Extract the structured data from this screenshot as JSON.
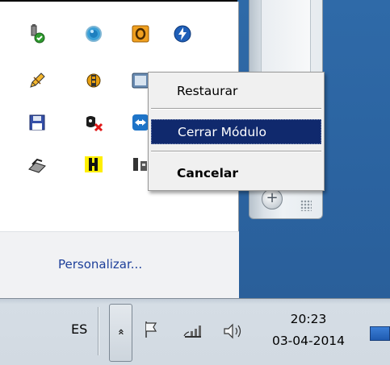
{
  "context_menu": {
    "items": [
      {
        "label": "Restaurar"
      },
      {
        "label": "Cerrar Módulo"
      },
      {
        "label": "Cancelar"
      }
    ]
  },
  "overflow_panel": {
    "customize_label": "Personalizar...",
    "icons": [
      "usb-device-icon",
      "blue-orb-icon",
      "orange-o-app-icon",
      "lightning-bolt-icon",
      "pencil-icon",
      "chip-gear-icon",
      "monitor-app-icon",
      "floppy-disk-icon",
      "network-error-icon",
      "teamviewer-icon",
      "scanner-icon",
      "yellow-plug-icon",
      "network-plug-icon"
    ]
  },
  "taskbar": {
    "language": "ES",
    "chevron": "«",
    "time": "20:23",
    "date": "03-04-2014"
  },
  "colors": {
    "menu_highlight": "#10296d",
    "link": "#1d3f9a",
    "desktop": "#2f6aa8"
  }
}
